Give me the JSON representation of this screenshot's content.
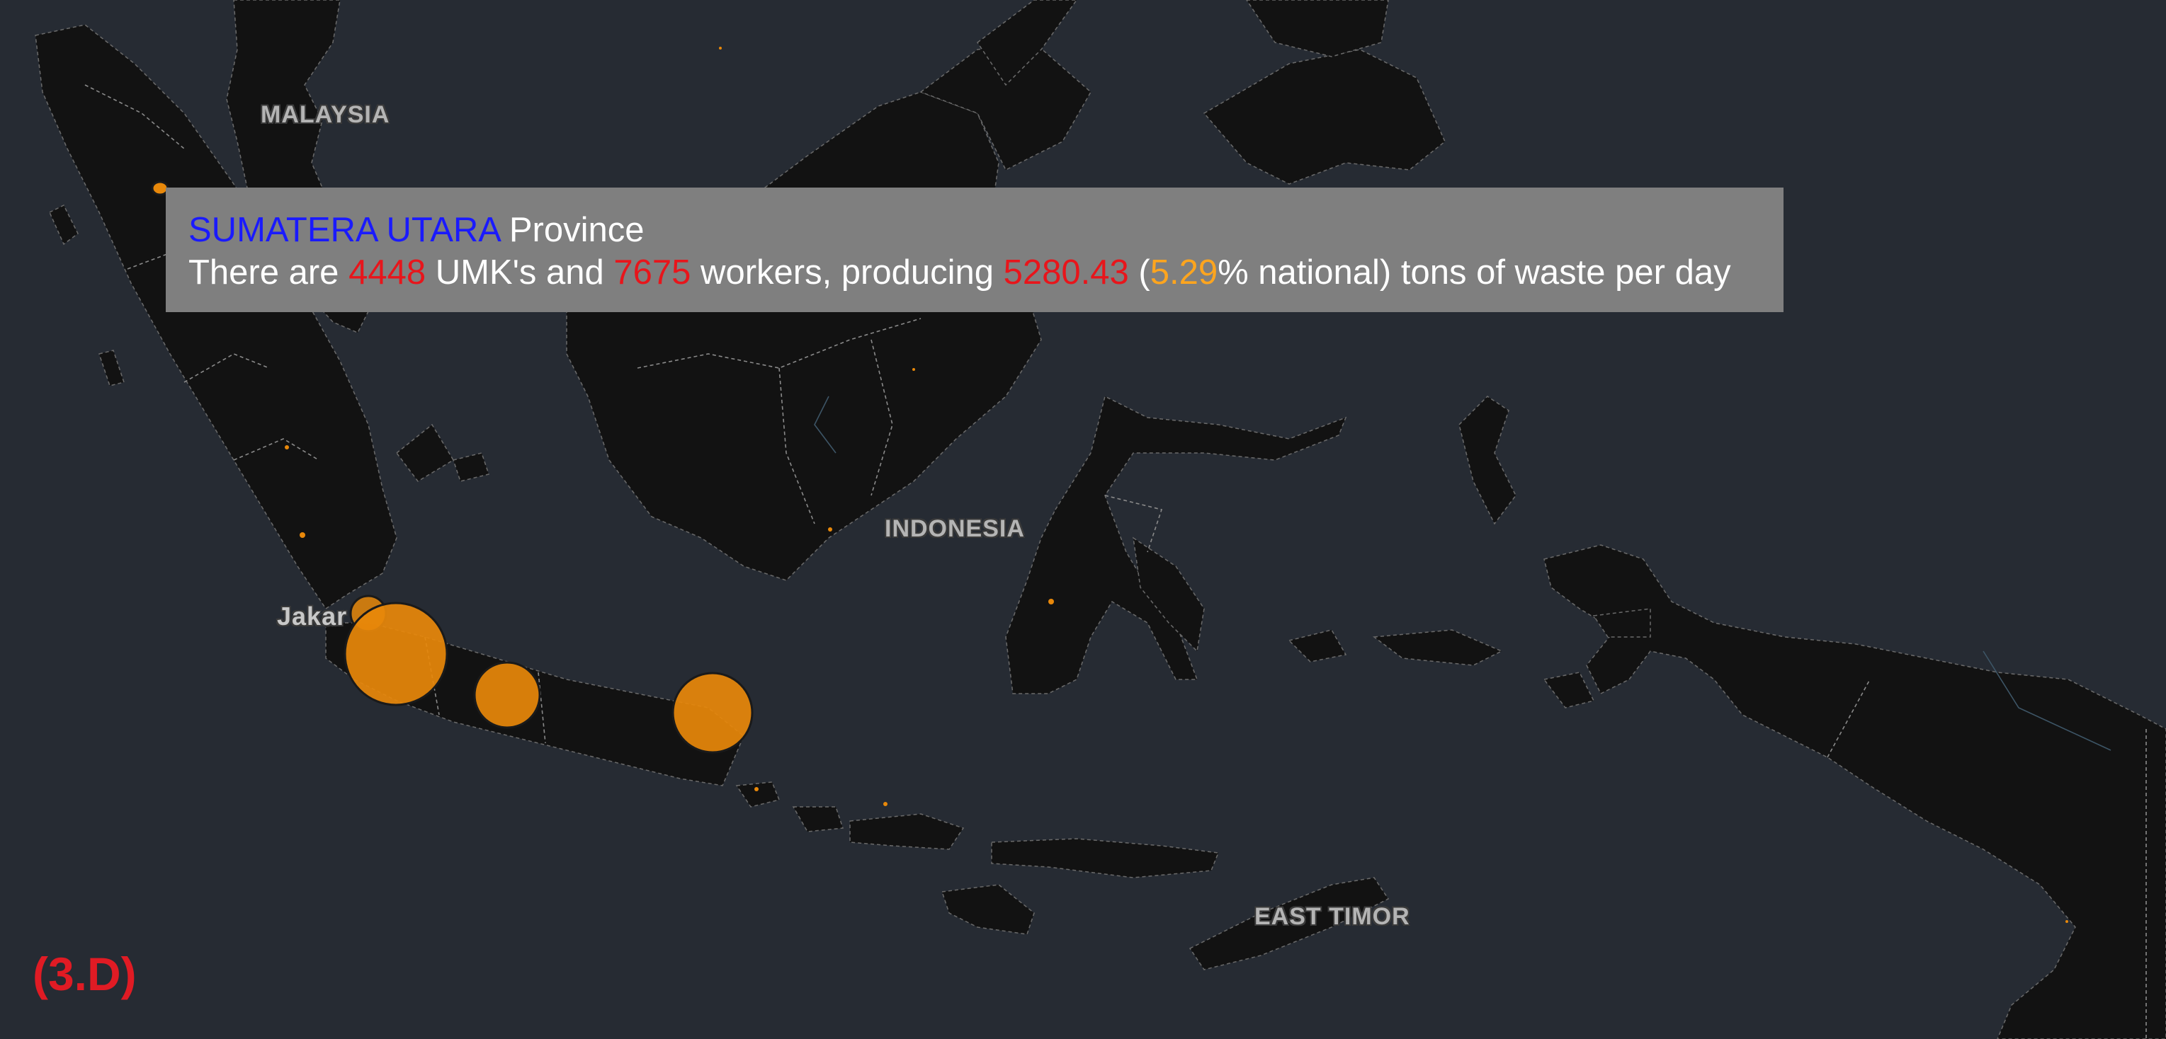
{
  "map": {
    "labels": {
      "malaysia": "MALAYSIA",
      "indonesia": "INDONESIA",
      "east_timor": "EAST TIMOR",
      "jakarta": "Jakar"
    },
    "colors": {
      "sea": "#262b33",
      "land": "#121212",
      "marker": "#e8880a",
      "marker_stroke": "#1a1a1a"
    },
    "markers": [
      {
        "name": "sumatera-utara",
        "size": "small"
      },
      {
        "name": "jakarta",
        "size": "small"
      },
      {
        "name": "banten",
        "size": "medium"
      },
      {
        "name": "jawa-barat",
        "size": "large"
      },
      {
        "name": "jawa-tengah",
        "size": "large"
      },
      {
        "name": "jawa-timur",
        "size": "large"
      }
    ]
  },
  "tooltip": {
    "province_name": "SUMATERA UTARA",
    "province_suffix": " Province",
    "text_prefix": "There are ",
    "umk_count": "4448",
    "text_umk": " UMK's and ",
    "workers": "7675",
    "text_workers": " workers, producing ",
    "waste_tons": "5280.43",
    "text_open": " (",
    "national_pct": "5.29",
    "text_close": "% national) tons of waste per day"
  },
  "panel_tag": "(3.D)"
}
